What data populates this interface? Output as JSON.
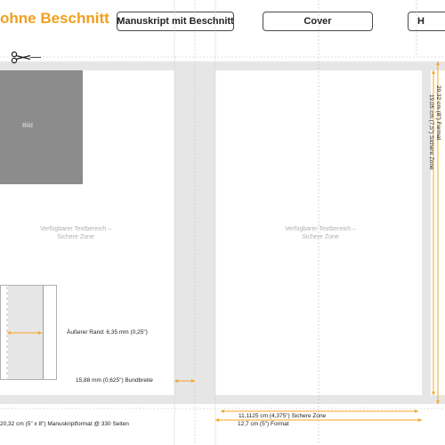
{
  "header": {
    "title_partial": "ohne Beschnitt",
    "tab_manuscript": "Manuskript mit Beschnitt",
    "tab_cover": "Cover",
    "tab_right_partial": "H"
  },
  "page": {
    "image_placeholder_label": "Bild",
    "safe_zone_label_line1": "Verfügbarer Textbereich –",
    "safe_zone_label_line2": "Sichere Zone"
  },
  "annotations": {
    "outer_margin": "Äußerer Rand: 6,35 mm (0,25\")",
    "spine_width": "15,88 mm (0,625\") Bundbreite",
    "manuscript_format": "20,32 cm (5\" x 8\") Manuskriptformat @ 330 Seiten",
    "safe_zone_width": "11,1125 cm (4,375\") Sichere Zone",
    "format_width": "12,7 cm (5\") Format",
    "height_format": "20,32 cm (8\") Format",
    "height_safe_zone": "19,05 cm (7,5\") Sichere Zone"
  },
  "colors": {
    "accent_orange": "#f0a01e",
    "bleed_gray": "#e6e6e6",
    "image_gray": "#8c8c8c",
    "dimension_line": "#f5a623"
  },
  "icons": {
    "scissors": "scissors-icon"
  }
}
